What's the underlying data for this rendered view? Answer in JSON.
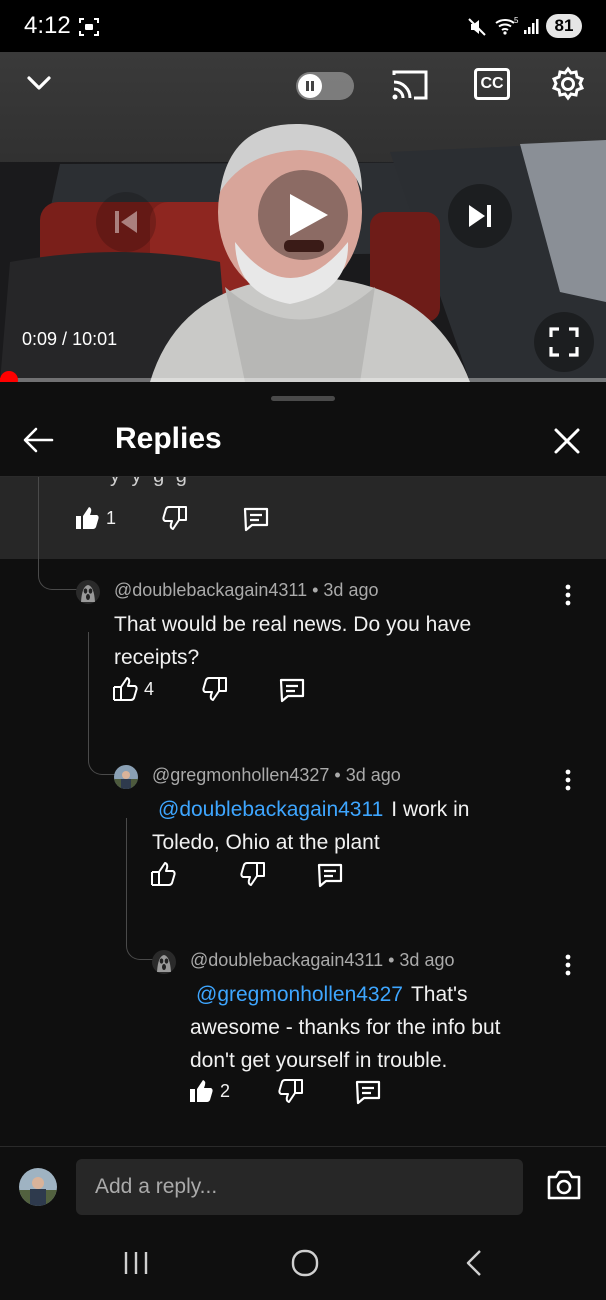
{
  "status_bar": {
    "time": "4:12",
    "battery": "81",
    "wifi_label": "5",
    "icons": [
      "screen-record-icon",
      "mute-icon",
      "wifi-icon",
      "signal-icon",
      "battery-icon"
    ]
  },
  "player": {
    "time_current": "0:09",
    "time_total": "10:01",
    "time_separator": " / ",
    "progress_fraction": 0.015,
    "autoplay_toggle_on": false,
    "icons": [
      "chevron-down-icon",
      "autoplay-toggle-icon",
      "cast-icon",
      "captions-icon",
      "gear-icon",
      "previous-icon",
      "play-icon",
      "next-icon",
      "fullscreen-icon"
    ],
    "captions_label": "CC"
  },
  "panel": {
    "title": "Replies",
    "top_comment_likes": "1",
    "top_comment_cut_text": "y   y            g       g"
  },
  "replies": [
    {
      "author": "@doublebackagain4311",
      "age": "3d ago",
      "separator": " • ",
      "mention": "",
      "text": "That would be real news. Do you have receipts?",
      "likes": "4",
      "liked": false
    },
    {
      "author": "@gregmonhollen4327",
      "age": "3d ago",
      "separator": " • ",
      "mention": "@doublebackagain4311",
      "text": "I work in Toledo, Ohio at the plant",
      "likes": "",
      "liked": false
    },
    {
      "author": "@doublebackagain4311",
      "age": "3d ago",
      "separator": " • ",
      "mention": "@gregmonhollen4327",
      "text": "That's awesome - thanks for the info but don't get yourself in trouble.",
      "likes": "2",
      "liked": true
    }
  ],
  "composer": {
    "placeholder": "Add a reply..."
  },
  "nav": {
    "icons": [
      "recent-apps-icon",
      "home-icon",
      "back-icon"
    ]
  },
  "colors": {
    "background": "#0f0f0f",
    "surface": "#272727",
    "mention": "#3ea6ff",
    "progress": "#ff0000",
    "secondary_text": "#aaaaaa"
  }
}
